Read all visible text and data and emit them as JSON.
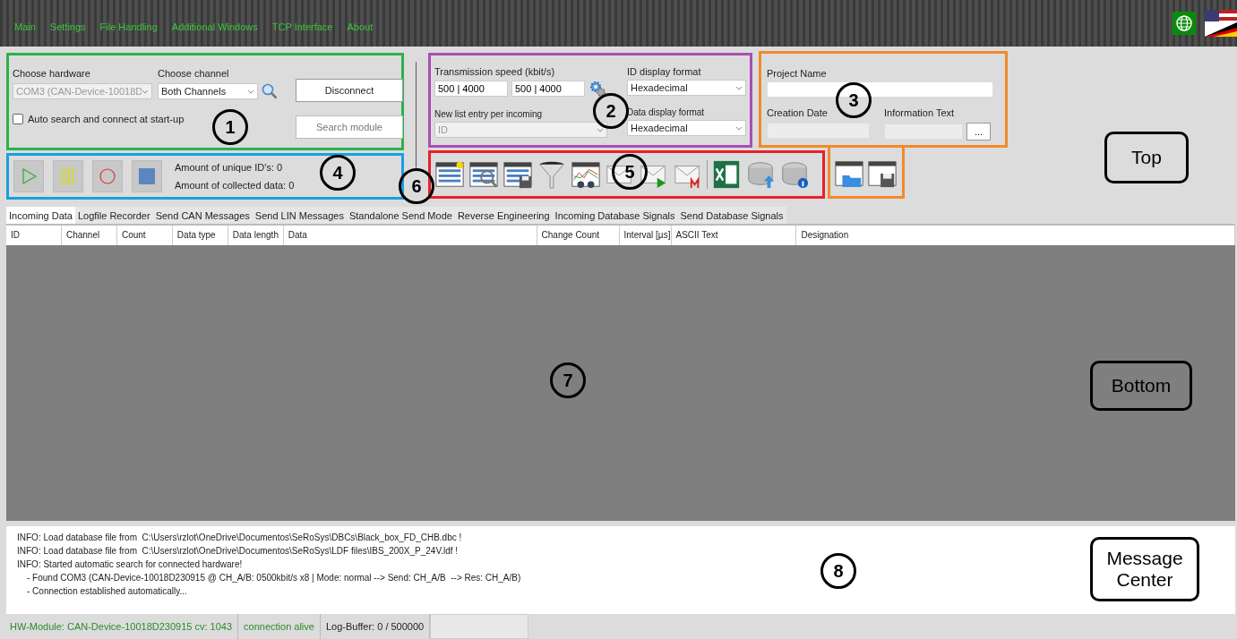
{
  "menu": [
    {
      "label": "Main"
    },
    {
      "label": "Settings"
    },
    {
      "label": "File Handling"
    },
    {
      "label": "Additional Windows"
    },
    {
      "label": "TCP Interface"
    },
    {
      "label": "About"
    }
  ],
  "hardware": {
    "label": "Choose hardware",
    "value": "COM3 (CAN-Device-10018D",
    "disabled": true
  },
  "channel": {
    "label": "Choose channel",
    "value": "Both Channels"
  },
  "auto_connect": {
    "label": "Auto search and connect at start-up",
    "checked": false
  },
  "connect_buttons": [
    {
      "label": "Disconnect",
      "disabled": false
    },
    {
      "label": "Search module",
      "disabled": true
    }
  ],
  "recording": {
    "unique_ids": "Amount of unique ID's: 0",
    "collected": "Amount of collected data: 0"
  },
  "transmission": {
    "label": "Transmission speed (kbit/s)",
    "values": [
      "500 | 4000",
      "500 | 4000"
    ]
  },
  "id_format": {
    "label": "ID display format",
    "value": "Hexadecimal"
  },
  "new_entry": {
    "label": "New list entry per incoming",
    "value": "ID",
    "disabled": true
  },
  "data_format": {
    "label": "Data display format",
    "value": "Hexadecimal"
  },
  "project": {
    "name_label": "Project Name",
    "date_label": "Creation Date",
    "info_label": "Information Text",
    "more_button": "..."
  },
  "tabs": [
    {
      "label": "Incoming Data",
      "selected": true
    },
    {
      "label": "Logfile Recorder",
      "selected": false
    },
    {
      "label": "Send CAN Messages",
      "selected": false
    },
    {
      "label": "Send LIN Messages",
      "selected": false
    },
    {
      "label": "Standalone Send Mode",
      "selected": false
    },
    {
      "label": "Reverse Engineering",
      "selected": false
    },
    {
      "label": "Incoming Database Signals",
      "selected": false
    },
    {
      "label": "Send Database Signals",
      "selected": false
    }
  ],
  "table": {
    "columns": [
      "ID",
      "Channel",
      "Count",
      "Data type",
      "Data length",
      "Data",
      "Change Count",
      "Interval [µs]",
      "ASCII Text",
      "Designation"
    ]
  },
  "messages": [
    {
      "kind": "info",
      "text": "INFO: Load database file from  C:\\Users\\rzlot\\OneDrive\\Documentos\\SeRoSys\\DBCs\\Black_box_FD_CHB.dbc !"
    },
    {
      "kind": "info",
      "text": "INFO: Load database file from  C:\\Users\\rzlot\\OneDrive\\Documentos\\SeRoSys\\LDF files\\IBS_200X_P_24V.ldf !"
    },
    {
      "kind": "info",
      "text": "INFO: Started automatic search for connected hardware!"
    },
    {
      "kind": "detail",
      "text": "- Found COM3 (CAN-Device-10018D230915 @ CH_A/B: 0500kbit/s x8 | Mode: normal --> Send: CH_A/B  --> Res: CH_A/B)"
    },
    {
      "kind": "detail",
      "text": "- Connection established automatically..."
    }
  ],
  "status_bar": [
    {
      "text": "HW-Module: CAN-Device-10018D230915  cv: 1043",
      "color": "#2e8b2e"
    },
    {
      "text": "connection alive",
      "color": "#2e8b2e"
    },
    {
      "text": "Log-Buffer: 0 / 500000",
      "color": "#222222"
    }
  ],
  "annotations": [
    {
      "kind": "number",
      "text": "1"
    },
    {
      "kind": "number",
      "text": "2"
    },
    {
      "kind": "number",
      "text": "3"
    },
    {
      "kind": "number",
      "text": "4"
    },
    {
      "kind": "number",
      "text": "5"
    },
    {
      "kind": "number",
      "text": "6"
    },
    {
      "kind": "number",
      "text": "7"
    },
    {
      "kind": "number",
      "text": "8"
    },
    {
      "kind": "label",
      "text": "Top"
    },
    {
      "kind": "label",
      "text": "Bottom"
    },
    {
      "kind": "label",
      "text": "Message Center"
    }
  ]
}
